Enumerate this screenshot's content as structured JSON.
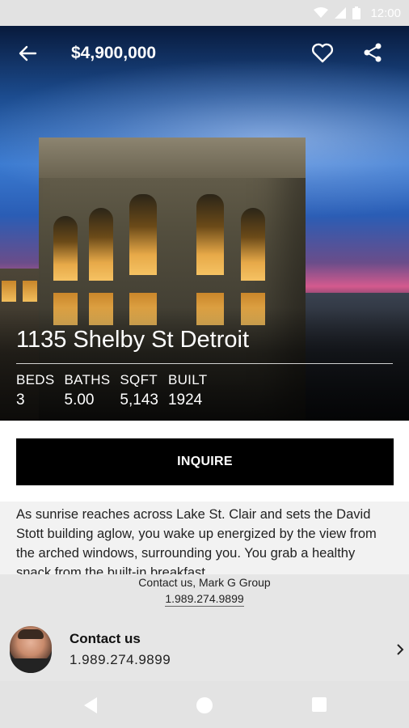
{
  "status_bar": {
    "time": "12:00"
  },
  "header": {
    "price": "$4,900,000"
  },
  "listing": {
    "address": "1135 Shelby St Detroit",
    "stats": [
      {
        "label": "BEDS",
        "value": "3"
      },
      {
        "label": "BATHS",
        "value": "5.00"
      },
      {
        "label": "SQFT",
        "value": "5,143"
      },
      {
        "label": "BUILT",
        "value": "1924"
      }
    ]
  },
  "cta": {
    "inquire_label": "INQUIRE"
  },
  "description": "As sunrise reaches across Lake St. Clair and sets the David Stott building aglow, you wake up energized by the view from the arched windows, surrounding you. You grab a healthy snack from the built-in breakfast",
  "contact_summary": {
    "line1": "Contact us, Mark G Group",
    "phone": "1.989.274.9899"
  },
  "agent": {
    "title": "Contact us",
    "phone": "1.989.274.9899"
  },
  "colors": {
    "button_bg": "#000000",
    "status_bar_bg": "#e2e2e2"
  },
  "icons": {
    "back": "arrow-left-icon",
    "favorite": "heart-outline-icon",
    "share": "share-icon",
    "chevron": "chevron-right-icon"
  }
}
